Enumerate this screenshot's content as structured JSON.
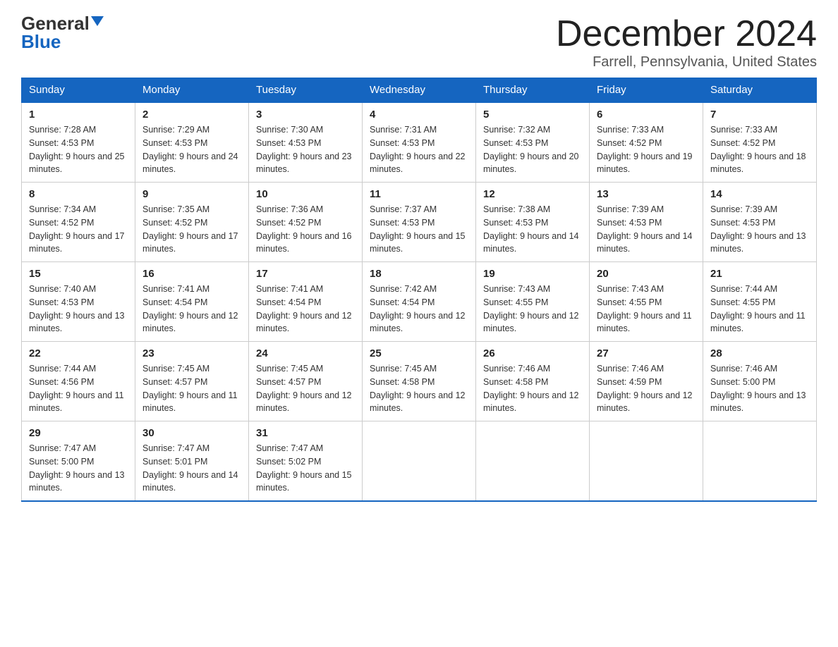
{
  "header": {
    "logo_general": "General",
    "logo_blue": "Blue",
    "title": "December 2024",
    "subtitle": "Farrell, Pennsylvania, United States"
  },
  "days_of_week": [
    "Sunday",
    "Monday",
    "Tuesday",
    "Wednesday",
    "Thursday",
    "Friday",
    "Saturday"
  ],
  "weeks": [
    [
      {
        "day": "1",
        "sunrise": "Sunrise: 7:28 AM",
        "sunset": "Sunset: 4:53 PM",
        "daylight": "Daylight: 9 hours and 25 minutes."
      },
      {
        "day": "2",
        "sunrise": "Sunrise: 7:29 AM",
        "sunset": "Sunset: 4:53 PM",
        "daylight": "Daylight: 9 hours and 24 minutes."
      },
      {
        "day": "3",
        "sunrise": "Sunrise: 7:30 AM",
        "sunset": "Sunset: 4:53 PM",
        "daylight": "Daylight: 9 hours and 23 minutes."
      },
      {
        "day": "4",
        "sunrise": "Sunrise: 7:31 AM",
        "sunset": "Sunset: 4:53 PM",
        "daylight": "Daylight: 9 hours and 22 minutes."
      },
      {
        "day": "5",
        "sunrise": "Sunrise: 7:32 AM",
        "sunset": "Sunset: 4:53 PM",
        "daylight": "Daylight: 9 hours and 20 minutes."
      },
      {
        "day": "6",
        "sunrise": "Sunrise: 7:33 AM",
        "sunset": "Sunset: 4:52 PM",
        "daylight": "Daylight: 9 hours and 19 minutes."
      },
      {
        "day": "7",
        "sunrise": "Sunrise: 7:33 AM",
        "sunset": "Sunset: 4:52 PM",
        "daylight": "Daylight: 9 hours and 18 minutes."
      }
    ],
    [
      {
        "day": "8",
        "sunrise": "Sunrise: 7:34 AM",
        "sunset": "Sunset: 4:52 PM",
        "daylight": "Daylight: 9 hours and 17 minutes."
      },
      {
        "day": "9",
        "sunrise": "Sunrise: 7:35 AM",
        "sunset": "Sunset: 4:52 PM",
        "daylight": "Daylight: 9 hours and 17 minutes."
      },
      {
        "day": "10",
        "sunrise": "Sunrise: 7:36 AM",
        "sunset": "Sunset: 4:52 PM",
        "daylight": "Daylight: 9 hours and 16 minutes."
      },
      {
        "day": "11",
        "sunrise": "Sunrise: 7:37 AM",
        "sunset": "Sunset: 4:53 PM",
        "daylight": "Daylight: 9 hours and 15 minutes."
      },
      {
        "day": "12",
        "sunrise": "Sunrise: 7:38 AM",
        "sunset": "Sunset: 4:53 PM",
        "daylight": "Daylight: 9 hours and 14 minutes."
      },
      {
        "day": "13",
        "sunrise": "Sunrise: 7:39 AM",
        "sunset": "Sunset: 4:53 PM",
        "daylight": "Daylight: 9 hours and 14 minutes."
      },
      {
        "day": "14",
        "sunrise": "Sunrise: 7:39 AM",
        "sunset": "Sunset: 4:53 PM",
        "daylight": "Daylight: 9 hours and 13 minutes."
      }
    ],
    [
      {
        "day": "15",
        "sunrise": "Sunrise: 7:40 AM",
        "sunset": "Sunset: 4:53 PM",
        "daylight": "Daylight: 9 hours and 13 minutes."
      },
      {
        "day": "16",
        "sunrise": "Sunrise: 7:41 AM",
        "sunset": "Sunset: 4:54 PM",
        "daylight": "Daylight: 9 hours and 12 minutes."
      },
      {
        "day": "17",
        "sunrise": "Sunrise: 7:41 AM",
        "sunset": "Sunset: 4:54 PM",
        "daylight": "Daylight: 9 hours and 12 minutes."
      },
      {
        "day": "18",
        "sunrise": "Sunrise: 7:42 AM",
        "sunset": "Sunset: 4:54 PM",
        "daylight": "Daylight: 9 hours and 12 minutes."
      },
      {
        "day": "19",
        "sunrise": "Sunrise: 7:43 AM",
        "sunset": "Sunset: 4:55 PM",
        "daylight": "Daylight: 9 hours and 12 minutes."
      },
      {
        "day": "20",
        "sunrise": "Sunrise: 7:43 AM",
        "sunset": "Sunset: 4:55 PM",
        "daylight": "Daylight: 9 hours and 11 minutes."
      },
      {
        "day": "21",
        "sunrise": "Sunrise: 7:44 AM",
        "sunset": "Sunset: 4:55 PM",
        "daylight": "Daylight: 9 hours and 11 minutes."
      }
    ],
    [
      {
        "day": "22",
        "sunrise": "Sunrise: 7:44 AM",
        "sunset": "Sunset: 4:56 PM",
        "daylight": "Daylight: 9 hours and 11 minutes."
      },
      {
        "day": "23",
        "sunrise": "Sunrise: 7:45 AM",
        "sunset": "Sunset: 4:57 PM",
        "daylight": "Daylight: 9 hours and 11 minutes."
      },
      {
        "day": "24",
        "sunrise": "Sunrise: 7:45 AM",
        "sunset": "Sunset: 4:57 PM",
        "daylight": "Daylight: 9 hours and 12 minutes."
      },
      {
        "day": "25",
        "sunrise": "Sunrise: 7:45 AM",
        "sunset": "Sunset: 4:58 PM",
        "daylight": "Daylight: 9 hours and 12 minutes."
      },
      {
        "day": "26",
        "sunrise": "Sunrise: 7:46 AM",
        "sunset": "Sunset: 4:58 PM",
        "daylight": "Daylight: 9 hours and 12 minutes."
      },
      {
        "day": "27",
        "sunrise": "Sunrise: 7:46 AM",
        "sunset": "Sunset: 4:59 PM",
        "daylight": "Daylight: 9 hours and 12 minutes."
      },
      {
        "day": "28",
        "sunrise": "Sunrise: 7:46 AM",
        "sunset": "Sunset: 5:00 PM",
        "daylight": "Daylight: 9 hours and 13 minutes."
      }
    ],
    [
      {
        "day": "29",
        "sunrise": "Sunrise: 7:47 AM",
        "sunset": "Sunset: 5:00 PM",
        "daylight": "Daylight: 9 hours and 13 minutes."
      },
      {
        "day": "30",
        "sunrise": "Sunrise: 7:47 AM",
        "sunset": "Sunset: 5:01 PM",
        "daylight": "Daylight: 9 hours and 14 minutes."
      },
      {
        "day": "31",
        "sunrise": "Sunrise: 7:47 AM",
        "sunset": "Sunset: 5:02 PM",
        "daylight": "Daylight: 9 hours and 15 minutes."
      },
      null,
      null,
      null,
      null
    ]
  ]
}
